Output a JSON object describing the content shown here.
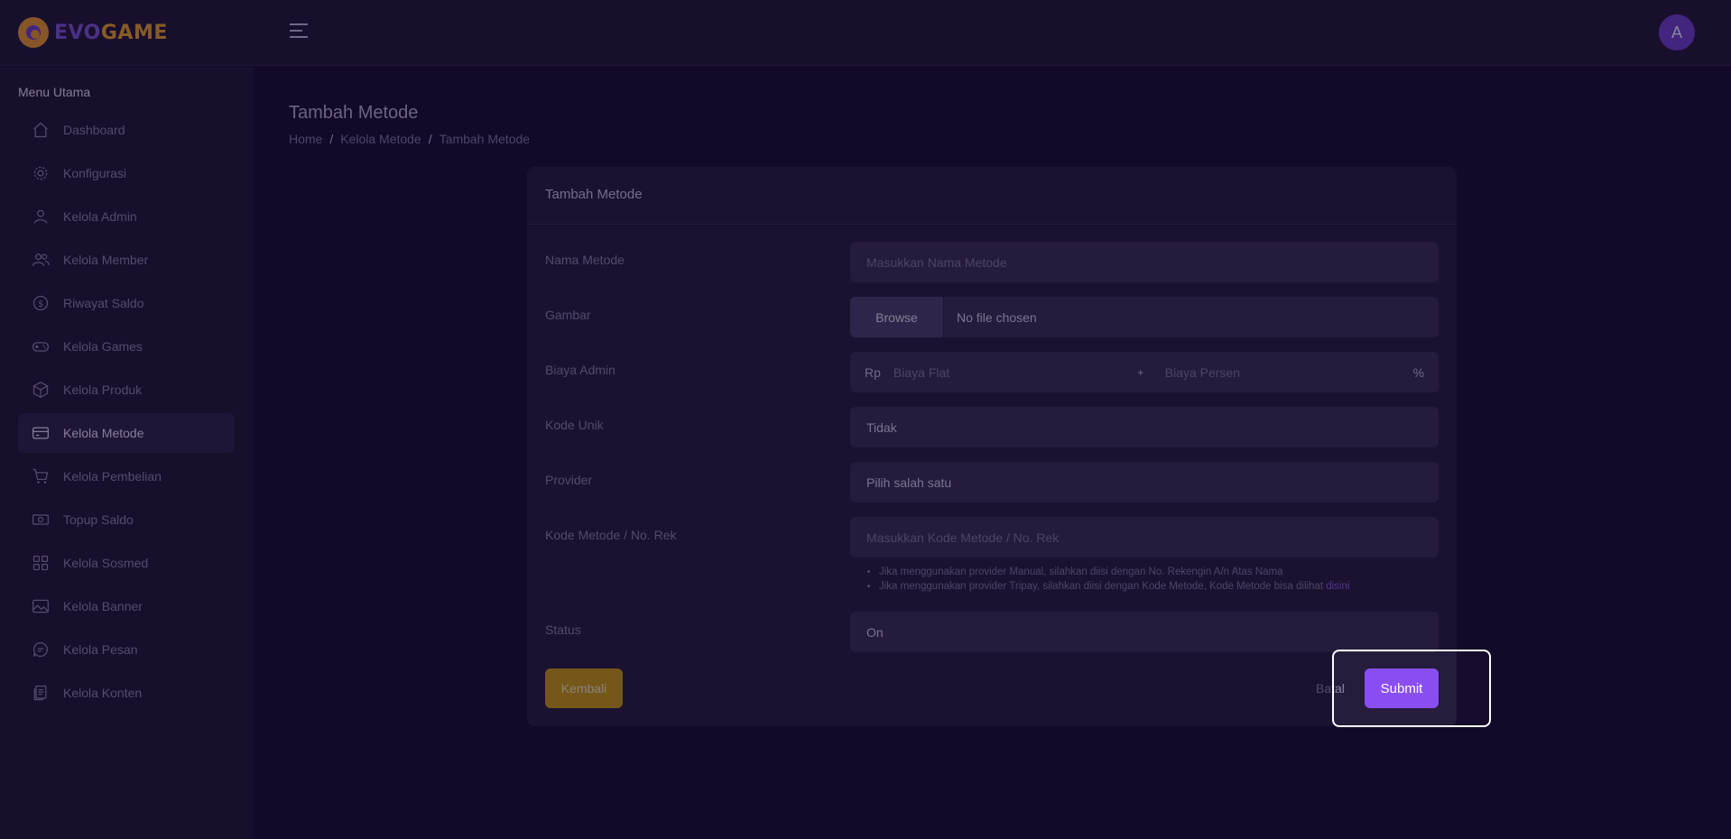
{
  "header": {
    "logo_part1": "EVO",
    "logo_part2": "GAME",
    "avatar_initial": "A"
  },
  "sidebar": {
    "title": "Menu Utama",
    "items": [
      {
        "label": "Dashboard",
        "icon": "home-icon"
      },
      {
        "label": "Konfigurasi",
        "icon": "gear-icon"
      },
      {
        "label": "Kelola Admin",
        "icon": "user-icon"
      },
      {
        "label": "Kelola Member",
        "icon": "users-icon"
      },
      {
        "label": "Riwayat Saldo",
        "icon": "dollar-circle-icon"
      },
      {
        "label": "Kelola Games",
        "icon": "gamepad-icon"
      },
      {
        "label": "Kelola Produk",
        "icon": "box-icon"
      },
      {
        "label": "Kelola Metode",
        "icon": "credit-card-icon",
        "active": true
      },
      {
        "label": "Kelola Pembelian",
        "icon": "cart-icon"
      },
      {
        "label": "Topup Saldo",
        "icon": "money-icon"
      },
      {
        "label": "Kelola Sosmed",
        "icon": "grid-icon"
      },
      {
        "label": "Kelola Banner",
        "icon": "image-icon"
      },
      {
        "label": "Kelola Pesan",
        "icon": "chat-icon"
      },
      {
        "label": "Kelola Konten",
        "icon": "files-icon"
      }
    ]
  },
  "page": {
    "title": "Tambah Metode",
    "breadcrumb": [
      "Home",
      "Kelola Metode",
      "Tambah Metode"
    ],
    "breadcrumb_sep": "/"
  },
  "form": {
    "card_title": "Tambah Metode",
    "nama_metode": {
      "label": "Nama Metode",
      "placeholder": "Masukkan Nama Metode"
    },
    "gambar": {
      "label": "Gambar",
      "button": "Browse",
      "value": "No file chosen"
    },
    "biaya_admin": {
      "label": "Biaya Admin",
      "prefix": "Rp",
      "flat_placeholder": "Biaya Flat",
      "plus": "+",
      "persen_placeholder": "Biaya Persen",
      "suffix": "%"
    },
    "kode_unik": {
      "label": "Kode Unik",
      "value": "Tidak"
    },
    "provider": {
      "label": "Provider",
      "value": "Pilih salah satu"
    },
    "kode_metode": {
      "label": "Kode Metode / No. Rek",
      "placeholder": "Masukkan Kode Metode / No. Rek",
      "hint1": "Jika menggunakan provider Manual, silahkan diisi dengan No. Rekengin A/n Atas Nama",
      "hint2": "Jika menggunakan provider Tripay, silahkan diisi dengan Kode Metode, Kode Metode bisa dilihat ",
      "hint2_link": "disini"
    },
    "status": {
      "label": "Status",
      "value": "On"
    },
    "back_button": "Kembali",
    "cancel_button": "Batal",
    "submit_button": "Submit"
  },
  "colors": {
    "background": "#170b2e",
    "panel": "#201636",
    "card": "#261c3c",
    "input": "#372d50",
    "accent": "#8a4df2",
    "warning": "#c69a12"
  }
}
